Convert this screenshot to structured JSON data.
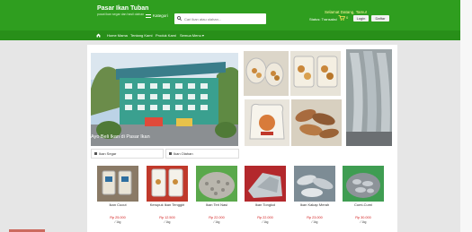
{
  "header": {
    "brand_name": "Pasar Ikan Tuban",
    "brand_tagline": "pusat ikan segar dan hasil olahan",
    "category_label": "Kategori",
    "search_placeholder": "Cari ikan atau olahan...",
    "welcome": "Selamat Datang, Tamu!",
    "status": "Status: Transaksi",
    "cart_count": "0",
    "login_label": "Login",
    "register_label": "Daftar"
  },
  "nav": {
    "items": [
      "Home Mama",
      "Tentang Kami",
      "Produk Kami",
      "Semua Menu ▾"
    ]
  },
  "hero": {
    "caption": "Ayo Beli Ikan di Pasar Ikan"
  },
  "tabs": [
    "Ikan Segar",
    "Ikan Olahan"
  ],
  "products": [
    {
      "name": "Ikan Cucut",
      "price": "Rp 25.000",
      "unit": "/ 1kg"
    },
    {
      "name": "Kerupuk Ikan Tenggiri",
      "price": "Rp 12.500",
      "unit": "/ 1kg"
    },
    {
      "name": "Ikan Teri Nasi",
      "price": "Rp 22.000",
      "unit": "/ 1kg"
    },
    {
      "name": "Ikan Tongkol",
      "price": "Rp 22.000",
      "unit": "/ 1kg"
    },
    {
      "name": "Ikan Kakap Merah",
      "price": "Rp 23.000",
      "unit": "/ 1kg"
    },
    {
      "name": "Cumi-Cumi",
      "price": "Rp 30.000",
      "unit": "/ 1kg"
    }
  ],
  "colors": {
    "header_green": "#2f9e1f",
    "nav_green": "#288f19",
    "price_red": "#d11a1a"
  }
}
